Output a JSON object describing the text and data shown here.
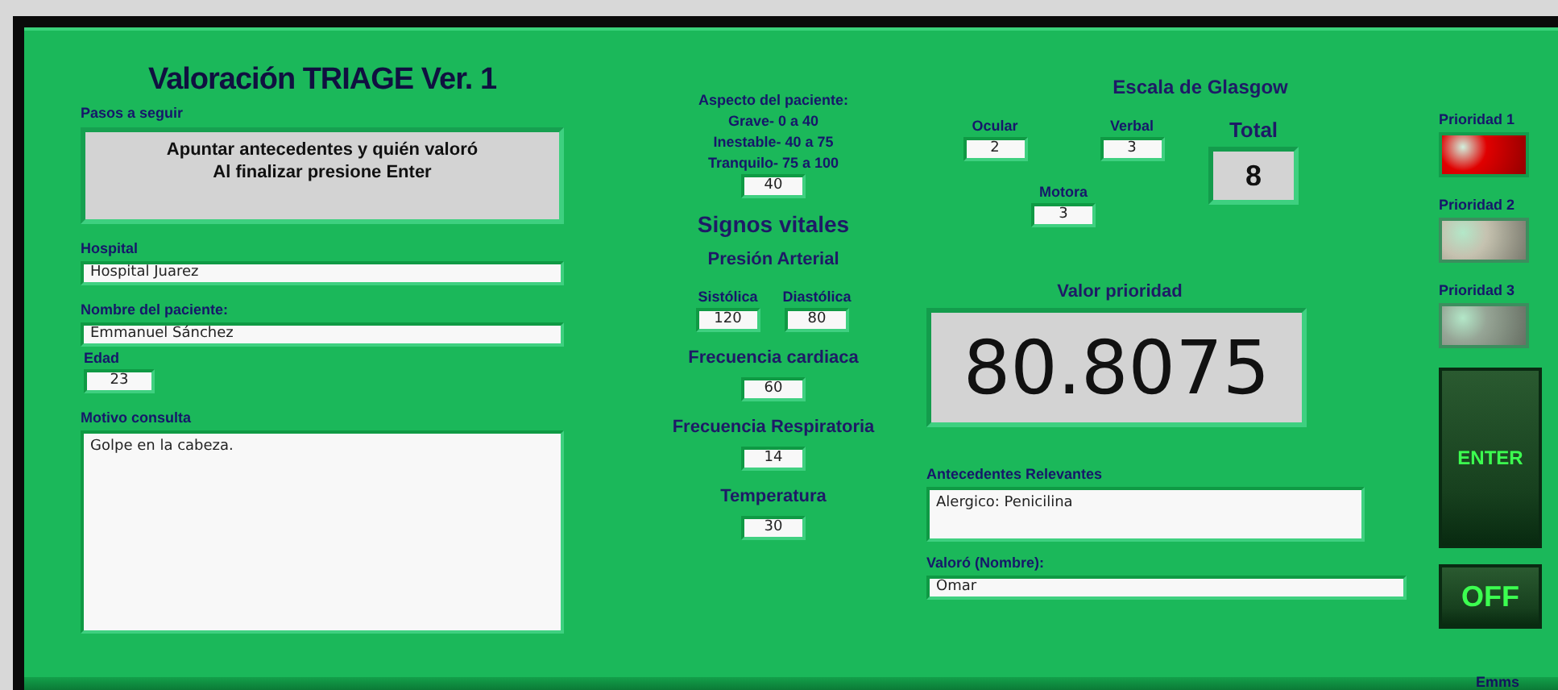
{
  "title": "Valoración TRIAGE Ver. 1",
  "steps": {
    "label": "Pasos a seguir",
    "lines": [
      "Apuntar antecedentes y quién valoró",
      "Al finalizar presione Enter"
    ]
  },
  "hospital": {
    "label": "Hospital",
    "value": "Hospital Juarez"
  },
  "patient_name": {
    "label": "Nombre del paciente:",
    "value": "Emmanuel Sánchez"
  },
  "age": {
    "label": "Edad",
    "value": "23"
  },
  "reason": {
    "label": "Motivo consulta",
    "value": "Golpe en la cabeza."
  },
  "appearance": {
    "label": "Aspecto del paciente:",
    "lines": [
      "Grave- 0 a 40",
      "Inestable- 40 a 75",
      "Tranquilo- 75 a 100"
    ],
    "value": "40"
  },
  "vital_signs": {
    "title": "Signos vitales",
    "pressure_title": "Presión Arterial",
    "systolic": {
      "label": "Sistólica",
      "value": "120"
    },
    "diastolic": {
      "label": "Diastólica",
      "value": "80"
    },
    "fields": [
      {
        "label": "Frecuencia cardiaca",
        "value": "60"
      },
      {
        "label": "Frecuencia Respiratoria",
        "value": "14"
      },
      {
        "label": "Temperatura",
        "value": "30"
      }
    ]
  },
  "glasgow": {
    "title": "Escala de Glasgow",
    "ocular": {
      "label": "Ocular",
      "value": "2"
    },
    "verbal": {
      "label": "Verbal",
      "value": "3"
    },
    "motor": {
      "label": "Motora",
      "value": "3"
    },
    "total_label": "Total",
    "total": "8"
  },
  "priority_value": {
    "label": "Valor prioridad",
    "value": "80.8075"
  },
  "history": {
    "label": "Antecedentes Relevantes",
    "value": "Alergico: Penicilina"
  },
  "assessed_by": {
    "label": "Valoró (Nombre):",
    "value": "Omar"
  },
  "lights": [
    {
      "label": "Prioridad 1",
      "on": true,
      "color": "#e00000"
    },
    {
      "label": "Prioridad 2",
      "on": false,
      "color": "#c8c2a4"
    },
    {
      "label": "Prioridad 3",
      "on": false,
      "color": "#8fa88e"
    }
  ],
  "buttons": [
    {
      "label": "ENTER",
      "kind": "tall"
    },
    {
      "label": "OFF",
      "kind": "short"
    }
  ],
  "footer": "Emms"
}
